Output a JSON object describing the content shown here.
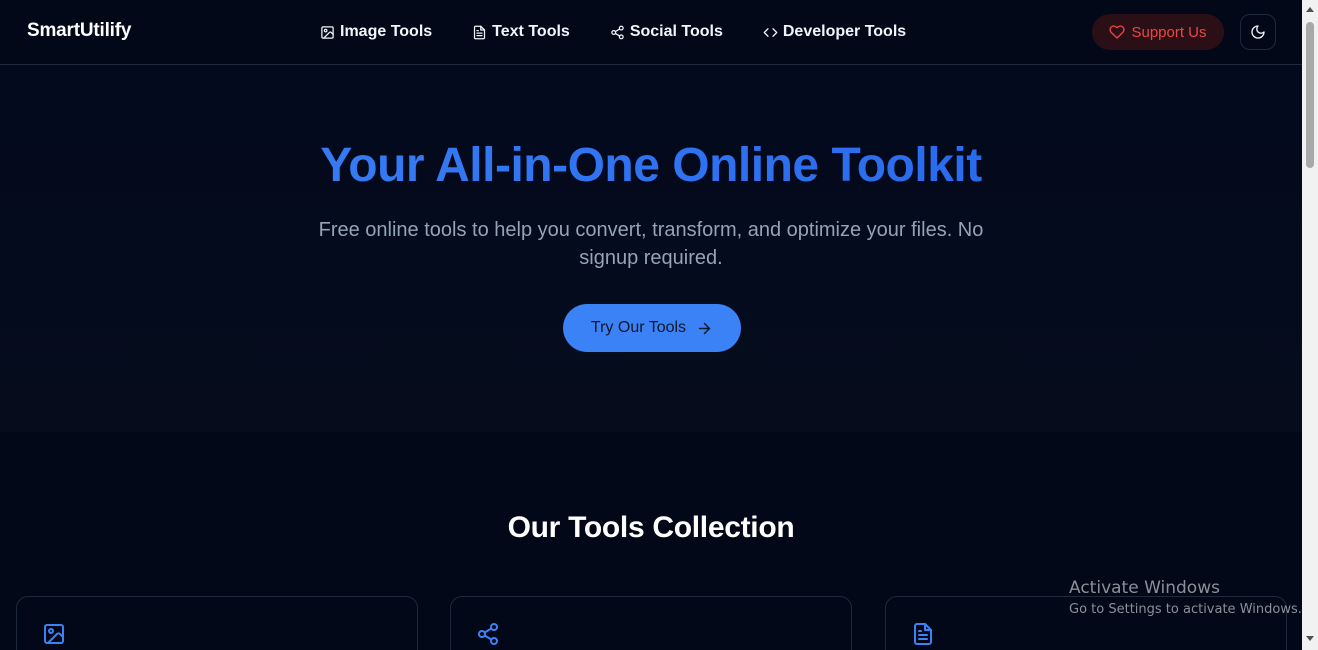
{
  "header": {
    "brand": "SmartUtilify",
    "nav": [
      {
        "label": "Image Tools",
        "icon": "image-icon"
      },
      {
        "label": "Text Tools",
        "icon": "file-text-icon"
      },
      {
        "label": "Social Tools",
        "icon": "share-icon"
      },
      {
        "label": "Developer Tools",
        "icon": "code-icon"
      }
    ],
    "support_label": "Support Us",
    "theme_toggle_icon": "moon-icon"
  },
  "hero": {
    "title": "Your All-in-One Online Toolkit",
    "subtitle": "Free online tools to help you convert, transform, and optimize your files. No signup required.",
    "cta_label": "Try Our Tools"
  },
  "tools_section": {
    "title": "Our Tools Collection",
    "cards": [
      {
        "icon": "image-icon"
      },
      {
        "icon": "share-icon"
      },
      {
        "icon": "file-text-icon"
      }
    ]
  },
  "watermark": {
    "title": "Activate Windows",
    "subtitle": "Go to Settings to activate Windows."
  },
  "colors": {
    "background": "#020817",
    "accent": "#3b82f6",
    "support_text": "#ef4444",
    "muted_text": "#94a3b8"
  }
}
